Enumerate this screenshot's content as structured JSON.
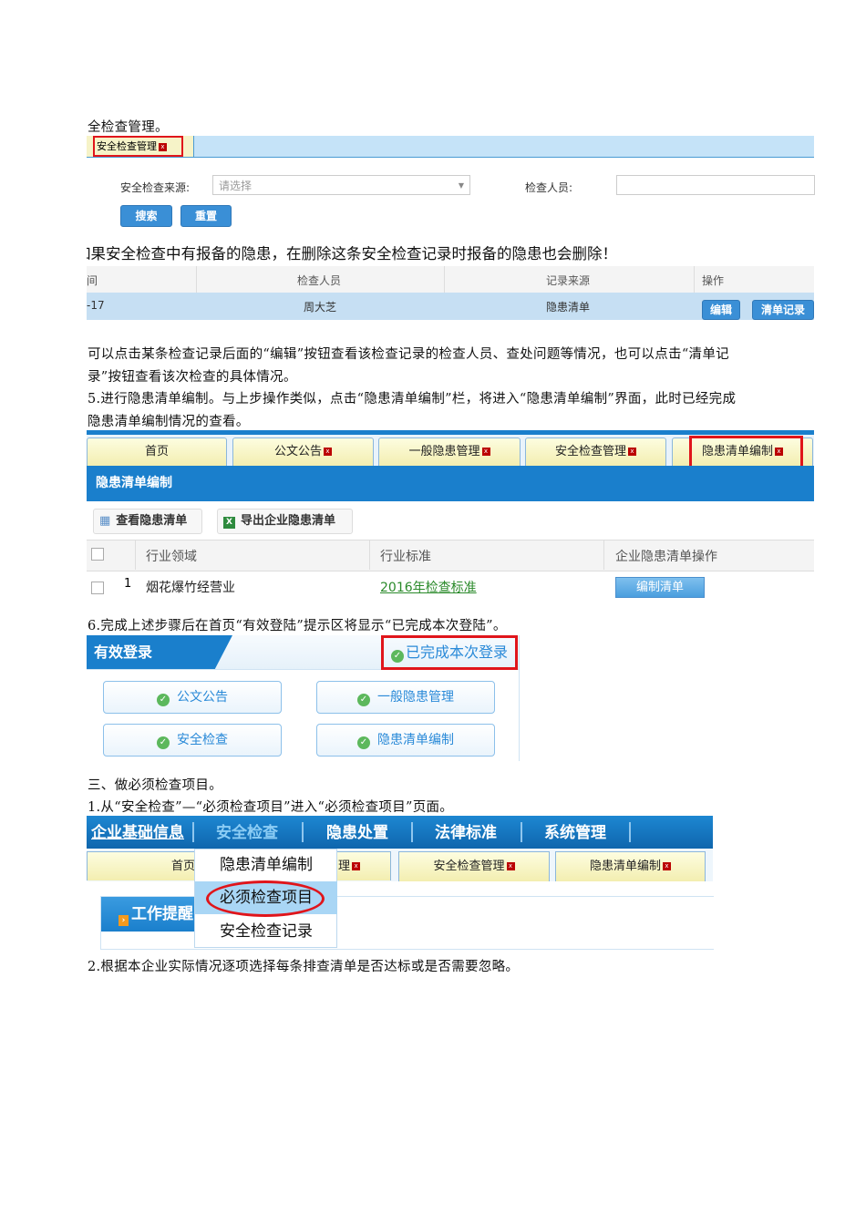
{
  "text": {
    "line1": "全检查管理。",
    "warning": "如果安全检查中有报备的隐患，在删除这条安全检查记录时报备的隐患也会删除！",
    "para1a": "可以点击某条检查记录后面的“编辑”按钮查看该检查记录的检查人员、查处问题等情况，也可以点击“清单记",
    "para1b": "录”按钮查看该次检查的具体情况。",
    "para2a": "5.进行隐患清单编制。与上步操作类似，点击“隐患清单编制”栏，将进入“隐患清单编制”界面，此时已经完成",
    "para2b": "隐患清单编制情况的查看。",
    "para3": "6.完成上述步骤后在首页“有效登陆”提示区将显示“已完成本次登陆”。",
    "para4": "三、做必须检查项目。",
    "para5": "1.从“安全检查”—“必须检查项目”进入“必须检查项目”页面。",
    "para6": "2.根据本企业实际情况逐项选择每条排查清单是否达标或是否需要忽略。"
  },
  "shot1": {
    "tab": "安全检查管理",
    "source_label": "安全检查来源:",
    "source_placeholder": "请选择",
    "inspector_label": "检查人员:",
    "search": "搜索",
    "reset": "重置",
    "headers": [
      "间",
      "检查人员",
      "记录来源",
      "操作"
    ],
    "row": {
      "date": "-17",
      "inspector": "周大芝",
      "source": "隐患清单",
      "edit": "编辑",
      "record": "清单记录"
    }
  },
  "shot2": {
    "tabs": [
      "首页",
      "公文公告",
      "一般隐患管理",
      "安全检查管理",
      "隐患清单编制"
    ],
    "title": "隐患清单编制",
    "toolbar": [
      "查看隐患清单",
      "导出企业隐患清单"
    ],
    "headers": [
      "行业领域",
      "行业标准",
      "企业隐患清单操作"
    ],
    "row": {
      "num": "1",
      "field": "烟花爆竹经营业",
      "standard": "2016年检查标准",
      "action": "编制清单"
    }
  },
  "shot3": {
    "title": "有效登录",
    "status": "已完成本次登录",
    "buttons": [
      "公文公告",
      "一般隐患管理",
      "安全检查",
      "隐患清单编制"
    ]
  },
  "shot4": {
    "nav": [
      "企业基础信息",
      "安全检查",
      "隐患处置",
      "法律标准",
      "系统管理"
    ],
    "tabs": [
      "首页",
      "理",
      "安全检查管理",
      "隐患清单编制"
    ],
    "menu": [
      "隐患清单编制",
      "必须检查项目",
      "安全检查记录"
    ],
    "panel": "工作提醒"
  }
}
